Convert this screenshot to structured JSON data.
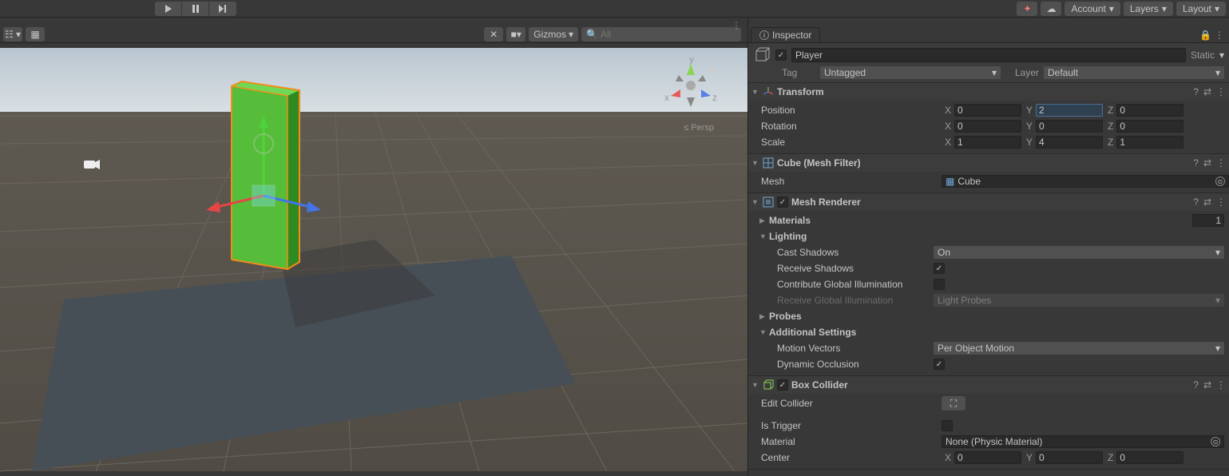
{
  "toolbar": {
    "account": "Account",
    "layers": "Layers",
    "layout": "Layout"
  },
  "scene": {
    "gizmos": "Gizmos",
    "searchPlaceholder": "All",
    "persp": "Persp",
    "axes": {
      "x": "x",
      "y": "y",
      "z": "z"
    }
  },
  "inspector": {
    "tab": "Inspector",
    "name": "Player",
    "static": "Static",
    "tagLabel": "Tag",
    "tagValue": "Untagged",
    "layerLabel": "Layer",
    "layerValue": "Default",
    "transform": {
      "title": "Transform",
      "position": {
        "label": "Position",
        "x": "0",
        "y": "2",
        "z": "0"
      },
      "rotation": {
        "label": "Rotation",
        "x": "0",
        "y": "0",
        "z": "0"
      },
      "scale": {
        "label": "Scale",
        "x": "1",
        "y": "4",
        "z": "1"
      }
    },
    "meshFilter": {
      "title": "Cube (Mesh Filter)",
      "meshLabel": "Mesh",
      "meshValue": "Cube"
    },
    "meshRenderer": {
      "title": "Mesh Renderer",
      "materialsLabel": "Materials",
      "materialsCount": "1",
      "lightingLabel": "Lighting",
      "castShadowsLabel": "Cast Shadows",
      "castShadowsValue": "On",
      "receiveShadowsLabel": "Receive Shadows",
      "contributeGILabel": "Contribute Global Illumination",
      "receiveGILabel": "Receive Global Illumination",
      "receiveGIValue": "Light Probes",
      "probesLabel": "Probes",
      "additionalLabel": "Additional Settings",
      "motionVectorsLabel": "Motion Vectors",
      "motionVectorsValue": "Per Object Motion",
      "dynOccLabel": "Dynamic Occlusion"
    },
    "boxCollider": {
      "title": "Box Collider",
      "editColliderLabel": "Edit Collider",
      "isTriggerLabel": "Is Trigger",
      "materialLabel": "Material",
      "materialValue": "None (Physic Material)",
      "centerLabel": "Center",
      "center": {
        "x": "0",
        "y": "0",
        "z": "0"
      }
    }
  }
}
